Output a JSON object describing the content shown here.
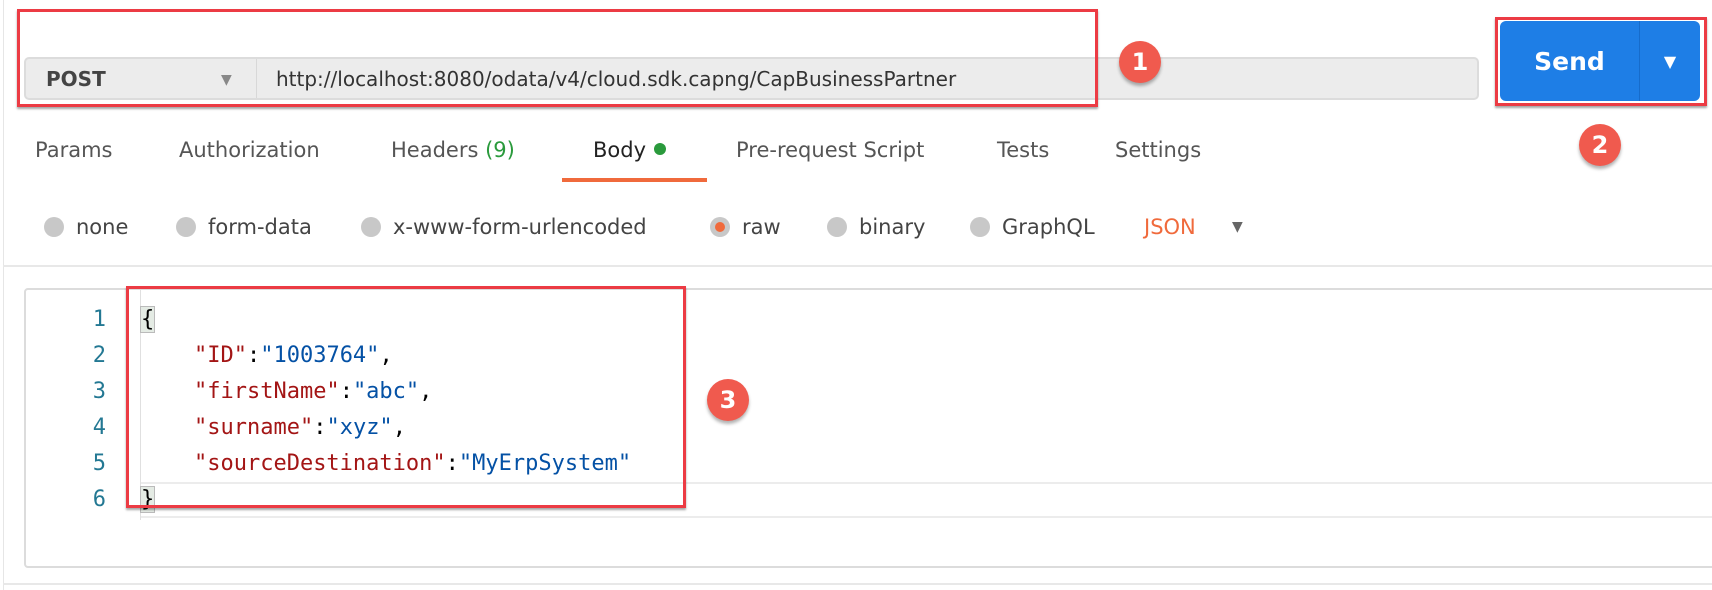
{
  "request": {
    "method": "POST",
    "url": "http://localhost:8080/odata/v4/cloud.sdk.capng/CapBusinessPartner",
    "send_label": "Send"
  },
  "tabs": [
    {
      "label": "Params"
    },
    {
      "label": "Authorization"
    },
    {
      "label": "Headers",
      "count": "(9)"
    },
    {
      "label": "Body",
      "active": true
    },
    {
      "label": "Pre-request Script"
    },
    {
      "label": "Tests"
    },
    {
      "label": "Settings"
    }
  ],
  "body_types": [
    {
      "label": "none"
    },
    {
      "label": "form-data"
    },
    {
      "label": "x-www-form-urlencoded"
    },
    {
      "label": "raw",
      "selected": true
    },
    {
      "label": "binary"
    },
    {
      "label": "GraphQL"
    }
  ],
  "raw_format": "JSON",
  "editor": {
    "line_numbers": [
      "1",
      "2",
      "3",
      "4",
      "5",
      "6"
    ],
    "lines": [
      {
        "p1": "{"
      },
      {
        "key": "\"ID\"",
        "sep": ":",
        "val": "\"1003764\"",
        "end": ","
      },
      {
        "key": "\"firstName\"",
        "sep": ":",
        "val": "\"abc\"",
        "end": ","
      },
      {
        "key": "\"surname\"",
        "sep": ":",
        "val": "\"xyz\"",
        "end": ","
      },
      {
        "key": "\"sourceDestination\"",
        "sep": ":",
        "val": "\"MyErpSystem\"",
        "end": ""
      },
      {
        "p1": "}"
      }
    ]
  },
  "annotations": [
    "1",
    "2",
    "3"
  ],
  "colors": {
    "accent": "#f06a3c",
    "send": "#1e7ee6",
    "annotation": "#ec3b44"
  }
}
